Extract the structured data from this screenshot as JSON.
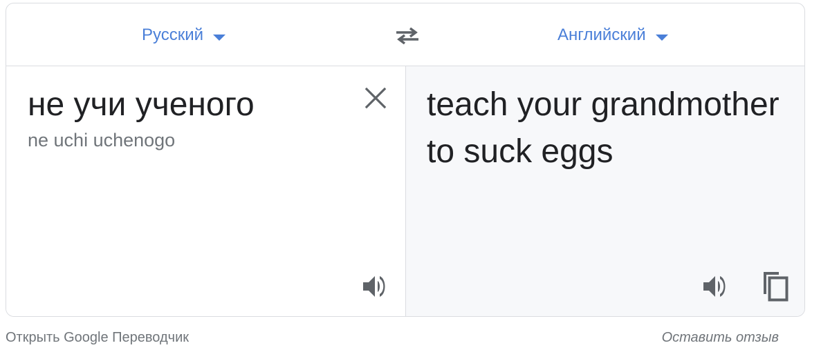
{
  "header": {
    "source_language": "Русский",
    "target_language": "Английский"
  },
  "source": {
    "text": "не учи ученого",
    "transliteration": "ne uchi uchenogo"
  },
  "target": {
    "text": "teach your grandmother to suck eggs"
  },
  "footer": {
    "open_link": "Открыть Google Переводчик",
    "feedback_link": "Оставить отзыв"
  },
  "icons": {
    "caret": "chevron-down-icon",
    "swap": "swap-icon",
    "clear": "close-icon",
    "speak": "speaker-icon",
    "copy": "copy-icon"
  },
  "colors": {
    "accent": "#4a7fd8",
    "icon": "#5f6368",
    "target_bg": "#f7f8fa"
  }
}
